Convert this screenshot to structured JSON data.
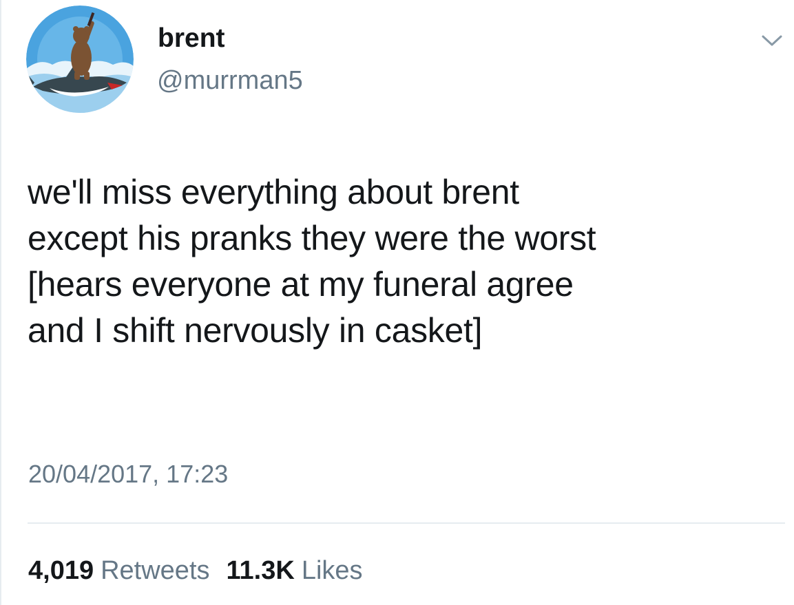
{
  "tweet": {
    "author": {
      "display_name": "brent",
      "handle": "@murrman5"
    },
    "text": "we'll miss everything about brent\nexcept his pranks they were the worst\n[hears everyone at my funeral agree\nand I shift nervously in casket]",
    "timestamp": "20/04/2017, 17:23",
    "stats": {
      "retweets_count": "4,019",
      "retweets_label": "Retweets",
      "likes_count": "11.3K",
      "likes_label": "Likes"
    }
  },
  "colors": {
    "text_primary": "#14171a",
    "text_secondary": "#657786",
    "divider": "#e6ecf0",
    "avatar_sky": "#4aa3df",
    "avatar_wave": "#e8f4fb"
  },
  "icons": {
    "menu": "chevron-down-icon",
    "avatar": "bear-riding-shark-avatar"
  }
}
